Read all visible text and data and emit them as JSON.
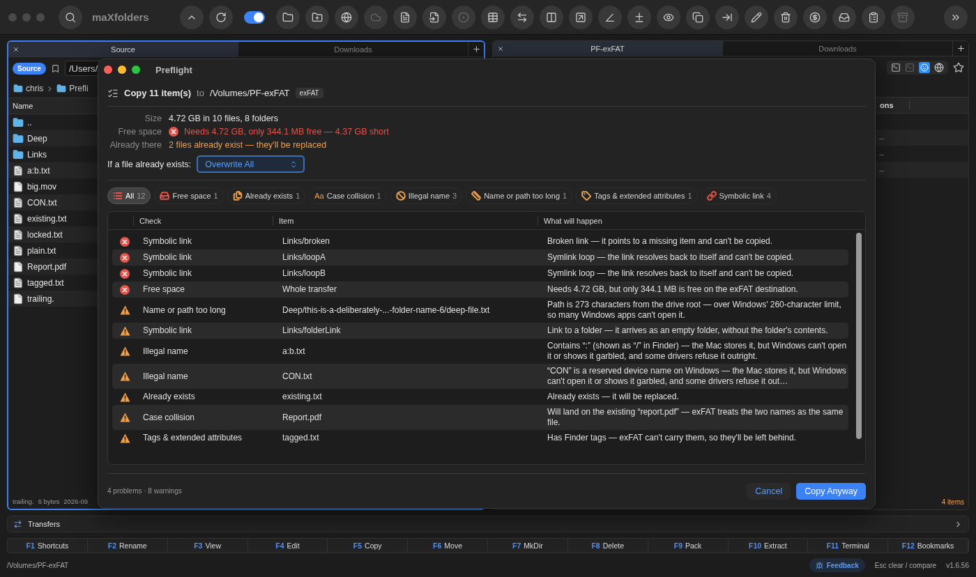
{
  "app": {
    "title": "maXfolders"
  },
  "toolbar": {
    "toggle": {
      "on": true
    },
    "buttons": [
      {
        "disabled": false
      },
      {
        "disabled": false
      },
      {
        "disabled": false
      },
      {
        "disabled": false
      },
      {
        "disabled": false
      },
      {
        "disabled": true
      },
      {
        "disabled": false
      },
      {
        "disabled": false
      },
      {
        "disabled": true
      },
      {
        "disabled": false
      },
      {
        "disabled": false
      },
      {
        "disabled": false
      },
      {
        "disabled": false
      },
      {
        "disabled": false
      },
      {
        "disabled": false
      },
      {
        "disabled": false
      },
      {
        "disabled": false
      },
      {
        "disabled": false
      },
      {
        "disabled": false
      },
      {
        "disabled": false
      },
      {
        "disabled": false
      },
      {
        "disabled": false
      },
      {
        "disabled": false
      },
      {
        "disabled": true
      }
    ]
  },
  "left_pane": {
    "active": true,
    "tabs": [
      {
        "label": "Source",
        "selected": true
      },
      {
        "label": "Downloads",
        "selected": false
      }
    ],
    "badge": "Source",
    "path": "/Users/",
    "breadcrumb": [
      "chris",
      "Prefli"
    ],
    "column": "Name",
    "files": [
      {
        "name": "..",
        "kind": "folder"
      },
      {
        "name": "Deep",
        "kind": "folder"
      },
      {
        "name": "Links",
        "kind": "folder"
      },
      {
        "name": "a:b.txt",
        "kind": "text"
      },
      {
        "name": "big.mov",
        "kind": "plain"
      },
      {
        "name": "CON.txt",
        "kind": "text"
      },
      {
        "name": "existing.txt",
        "kind": "text"
      },
      {
        "name": "locked.txt",
        "kind": "text"
      },
      {
        "name": "plain.txt",
        "kind": "text"
      },
      {
        "name": "Report.pdf",
        "kind": "plain"
      },
      {
        "name": "tagged.txt",
        "kind": "text"
      },
      {
        "name": "trailing.",
        "kind": "plain"
      }
    ],
    "footer": [
      "trailing.",
      "6 bytes",
      "2026-09"
    ]
  },
  "right_pane": {
    "active": false,
    "tabs": [
      {
        "label": "PF-exFAT",
        "selected": true
      },
      {
        "label": "Downloads",
        "selected": false
      }
    ],
    "column": "ons",
    "rows": [
      "--",
      "--",
      "--"
    ],
    "footer": "4 items"
  },
  "dialog": {
    "title": "Preflight",
    "operation": "Copy 11 item(s)",
    "to": "to",
    "destination": "/Volumes/PF-exFAT",
    "fs": "exFAT",
    "info": [
      {
        "label": "Size",
        "value": "4.72 GB in 10 files, 8 folders",
        "kind": "normal"
      },
      {
        "label": "Free space",
        "value": "Needs 4.72 GB, only 344.1 MB free — 4.37 GB short",
        "kind": "error"
      },
      {
        "label": "Already there",
        "value": "2 files already exist — they'll be replaced",
        "kind": "warning"
      }
    ],
    "conflict": {
      "label": "If a file already exists:",
      "value": "Overwrite All"
    },
    "filters": [
      {
        "label": "All",
        "count": "12",
        "kind": "all",
        "color": "#e5534b",
        "selected": true
      },
      {
        "label": "Free space",
        "count": "1",
        "kind": "space",
        "color": "#e5534b",
        "selected": false
      },
      {
        "label": "Already exists",
        "count": "1",
        "kind": "exists",
        "color": "#f0a04b",
        "selected": false
      },
      {
        "label": "Case collision",
        "count": "1",
        "kind": "case",
        "glyph": "Aa",
        "color": "#f0a04b",
        "selected": false
      },
      {
        "label": "Illegal name",
        "count": "3",
        "kind": "illegal",
        "color": "#f0a04b",
        "selected": false
      },
      {
        "label": "Name or path too long",
        "count": "1",
        "kind": "length",
        "color": "#f0a04b",
        "selected": false
      },
      {
        "label": "Tags & extended attributes",
        "count": "1",
        "kind": "tags",
        "color": "#f0a04b",
        "selected": false
      },
      {
        "label": "Symbolic link",
        "count": "4",
        "kind": "symlink",
        "color": "#e5534b",
        "selected": false
      }
    ],
    "table": {
      "columns": [
        "Check",
        "Item",
        "What will happen"
      ],
      "rows": [
        {
          "kind": "error",
          "check": "Symbolic link",
          "item": "Links/broken",
          "result": "Broken link — it points to a missing item and can't be copied."
        },
        {
          "kind": "error",
          "check": "Symbolic link",
          "item": "Links/loopA",
          "result": "Symlink loop — the link resolves back to itself and can't be copied."
        },
        {
          "kind": "error",
          "check": "Symbolic link",
          "item": "Links/loopB",
          "result": "Symlink loop — the link resolves back to itself and can't be copied."
        },
        {
          "kind": "error",
          "check": "Free space",
          "item": "Whole transfer",
          "result": "Needs 4.72 GB, but only 344.1 MB is free on the exFAT destination."
        },
        {
          "kind": "warning",
          "check": "Name or path too long",
          "item": "Deep/this-is-a-deliberately-...-folder-name-6/deep-file.txt",
          "result": "Path is 273 characters from the drive root — over Windows' 260-character limit, so many Windows apps can't open it."
        },
        {
          "kind": "warning",
          "check": "Symbolic link",
          "item": "Links/folderLink",
          "result": "Link to a folder — it arrives as an empty folder, without the folder's contents."
        },
        {
          "kind": "warning",
          "check": "Illegal name",
          "item": "a:b.txt",
          "result": "Contains “:” (shown as “/” in Finder) — the Mac stores it, but Windows can't open it or shows it garbled, and some drivers refuse it outright."
        },
        {
          "kind": "warning",
          "check": "Illegal name",
          "item": "CON.txt",
          "result": "“CON” is a reserved device name on Windows — the Mac stores it, but Windows can't open it or shows it garbled, and some drivers refuse it out…"
        },
        {
          "kind": "warning",
          "check": "Already exists",
          "item": "existing.txt",
          "result": "Already exists — it will be replaced."
        },
        {
          "kind": "warning",
          "check": "Case collision",
          "item": "Report.pdf",
          "result": "Will land on the existing “report.pdf” — exFAT treats the two names as the same file."
        },
        {
          "kind": "warning",
          "check": "Tags & extended attributes",
          "item": "tagged.txt",
          "result": "Has Finder tags — exFAT can't carry them, so they'll be left behind."
        }
      ]
    },
    "summary": "4 problems · 8 warnings",
    "buttons": [
      {
        "label": "Cancel",
        "kind": "secondary"
      },
      {
        "label": "Copy Anyway",
        "kind": "primary"
      }
    ]
  },
  "transfers": {
    "label": "Transfers"
  },
  "fkeys": [
    {
      "key": "F1",
      "label": "Shortcuts"
    },
    {
      "key": "F2",
      "label": "Rename"
    },
    {
      "key": "F3",
      "label": "View"
    },
    {
      "key": "F4",
      "label": "Edit"
    },
    {
      "key": "F5",
      "label": "Copy"
    },
    {
      "key": "F6",
      "label": "Move"
    },
    {
      "key": "F7",
      "label": "MkDir"
    },
    {
      "key": "F8",
      "label": "Delete"
    },
    {
      "key": "F9",
      "label": "Pack"
    },
    {
      "key": "F10",
      "label": "Extract"
    },
    {
      "key": "F11",
      "label": "Terminal"
    },
    {
      "key": "F12",
      "label": "Bookmarks"
    }
  ],
  "status": {
    "path": "/Volumes/PF-exFAT",
    "feedback": "Feedback",
    "hint": "Esc clear / compare",
    "version": "v1.6.56"
  }
}
